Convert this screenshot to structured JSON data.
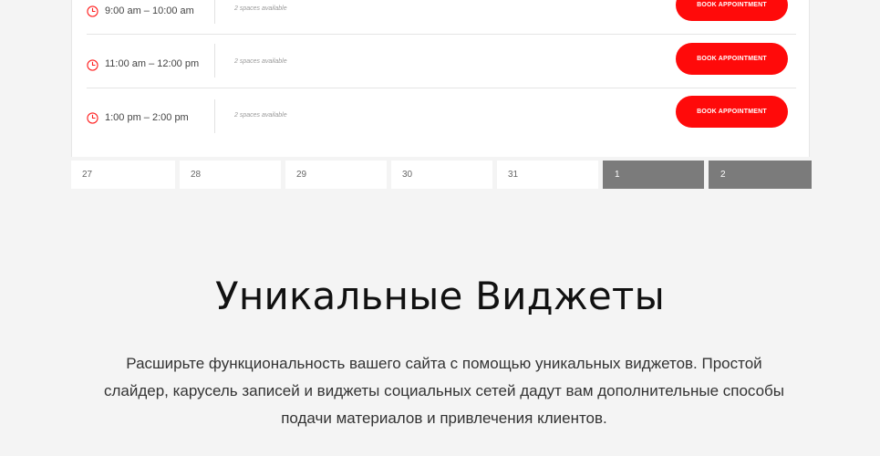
{
  "booking": {
    "slots": [
      {
        "time": "9:00 am – 10:00 am",
        "availability": "2 spaces available",
        "button": "Book Appointment"
      },
      {
        "time": "11:00 am – 12:00 pm",
        "availability": "2 spaces available",
        "button": "Book Appointment"
      },
      {
        "time": "1:00 pm – 2:00 pm",
        "availability": "2 spaces available",
        "button": "Book Appointment"
      }
    ],
    "dates": [
      "27",
      "28",
      "29",
      "30",
      "31",
      "1",
      "2"
    ],
    "active_dates": [
      "1",
      "2"
    ]
  },
  "section": {
    "title": "Уникальные Виджеты",
    "description": "Расширьте функциональность вашего сайта с помощью уникальных виджетов. Простой слайдер, карусель записей и виджеты социальных сетей дадут вам дополнительные способы подачи материалов и привлечения клиентов."
  },
  "colors": {
    "accent": "#ff0a0a",
    "active_date_bg": "#7b7b7b",
    "page_bg": "#f4f4f4"
  }
}
